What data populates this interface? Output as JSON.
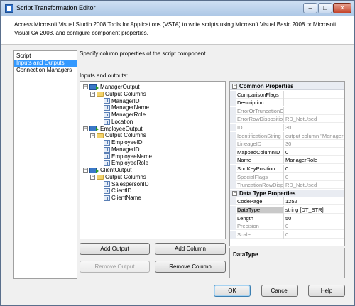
{
  "window": {
    "title": "Script Transformation Editor"
  },
  "header": {
    "description": "Access Microsoft Visual Studio 2008 Tools for Applications (VSTA) to write scripts using Microsoft Visual Basic 2008 or Microsoft Visual C# 2008, and configure component properties."
  },
  "nav": [
    {
      "label": "Script",
      "selected": false
    },
    {
      "label": "Inputs and Outputs",
      "selected": true
    },
    {
      "label": "Connection Managers",
      "selected": false
    }
  ],
  "main": {
    "prompt": "Specify column properties of the script component.",
    "io_label": "Inputs and outputs:"
  },
  "tree": {
    "outputs": [
      {
        "name": "ManagerOutput",
        "folder": "Output Columns",
        "columns": [
          "ManagerID",
          "ManagerName",
          "ManagerRole",
          "Location"
        ]
      },
      {
        "name": "EmployeeOutput",
        "folder": "Output Columns",
        "columns": [
          "EmployeeID",
          "ManagerID",
          "EmployeeName",
          "EmployeeRole"
        ]
      },
      {
        "name": "ClientOutput",
        "folder": "Output Columns",
        "columns": [
          "SalespersonID",
          "ClientID",
          "ClientName"
        ]
      }
    ]
  },
  "buttons": {
    "add_output": "Add Output",
    "add_column": "Add Column",
    "remove_output": "Remove Output",
    "remove_column": "Remove Column",
    "ok": "OK",
    "cancel": "Cancel",
    "help": "Help"
  },
  "properties": {
    "common_title": "Common Properties",
    "common": [
      {
        "name": "ComparisonFlags",
        "value": "",
        "readonly": false
      },
      {
        "name": "Description",
        "value": "",
        "readonly": false
      },
      {
        "name": "ErrorOrTruncationO",
        "value": "",
        "readonly": true
      },
      {
        "name": "ErrorRowDisposition",
        "value": "RD_NotUsed",
        "readonly": true
      },
      {
        "name": "ID",
        "value": "30",
        "readonly": true
      },
      {
        "name": "IdentificationString",
        "value": "output column \"ManagerR",
        "readonly": true
      },
      {
        "name": "LineageID",
        "value": "30",
        "readonly": true
      },
      {
        "name": "MappedColumnID",
        "value": "0",
        "readonly": false
      },
      {
        "name": "Name",
        "value": "ManagerRole",
        "readonly": false
      },
      {
        "name": "SortKeyPosition",
        "value": "0",
        "readonly": false
      },
      {
        "name": "SpecialFlags",
        "value": "0",
        "readonly": true
      },
      {
        "name": "TruncationRowDispo",
        "value": "RD_NotUsed",
        "readonly": true
      }
    ],
    "datatype_title": "Data Type Properties",
    "datatype": [
      {
        "name": "CodePage",
        "value": "1252",
        "readonly": false
      },
      {
        "name": "DataType",
        "value": "string [DT_STR]",
        "readonly": false,
        "highlight": true
      },
      {
        "name": "Length",
        "value": "50",
        "readonly": false
      },
      {
        "name": "Precision",
        "value": "0",
        "readonly": true
      },
      {
        "name": "Scale",
        "value": "0",
        "readonly": true
      }
    ]
  },
  "description_panel": {
    "title": "DataType"
  }
}
